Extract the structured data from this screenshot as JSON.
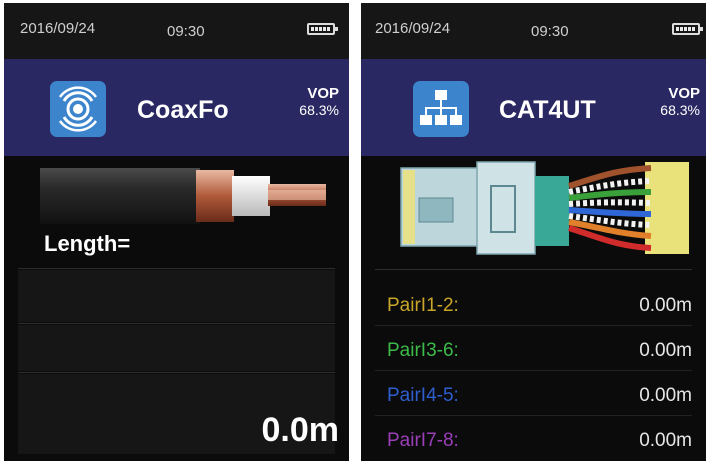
{
  "screens": [
    {
      "status": {
        "date": "2016/09/24",
        "time": "09:30",
        "battery_level": 1.0
      },
      "app": {
        "icon": "coax-radar-icon",
        "title": "CoaxFo"
      },
      "vop": {
        "label": "VOP",
        "value": "68.3%"
      },
      "measurement": {
        "label": "Length=",
        "value": "0.0m"
      }
    },
    {
      "status": {
        "date": "2016/09/24",
        "time": "09:30",
        "battery_level": 1.0
      },
      "app": {
        "icon": "network-tree-icon",
        "title": "CAT4UT"
      },
      "vop": {
        "label": "VOP",
        "value": "68.3%"
      },
      "pairs": [
        {
          "label": "PairI1-2:",
          "value": "0.00m",
          "color": "#c9a62a"
        },
        {
          "label": "PairI3-6:",
          "value": "0.00m",
          "color": "#3dbb4a"
        },
        {
          "label": "PairI4-5:",
          "value": "0.00m",
          "color": "#2f5ecf"
        },
        {
          "label": "PairI7-8:",
          "value": "0.00m",
          "color": "#9a3fb8"
        }
      ]
    }
  ],
  "colors": {
    "header": "#2a2862",
    "status_bar": "#161616",
    "screen_bg": "#0b0b0b",
    "icon_bg": "#3c84cc"
  }
}
